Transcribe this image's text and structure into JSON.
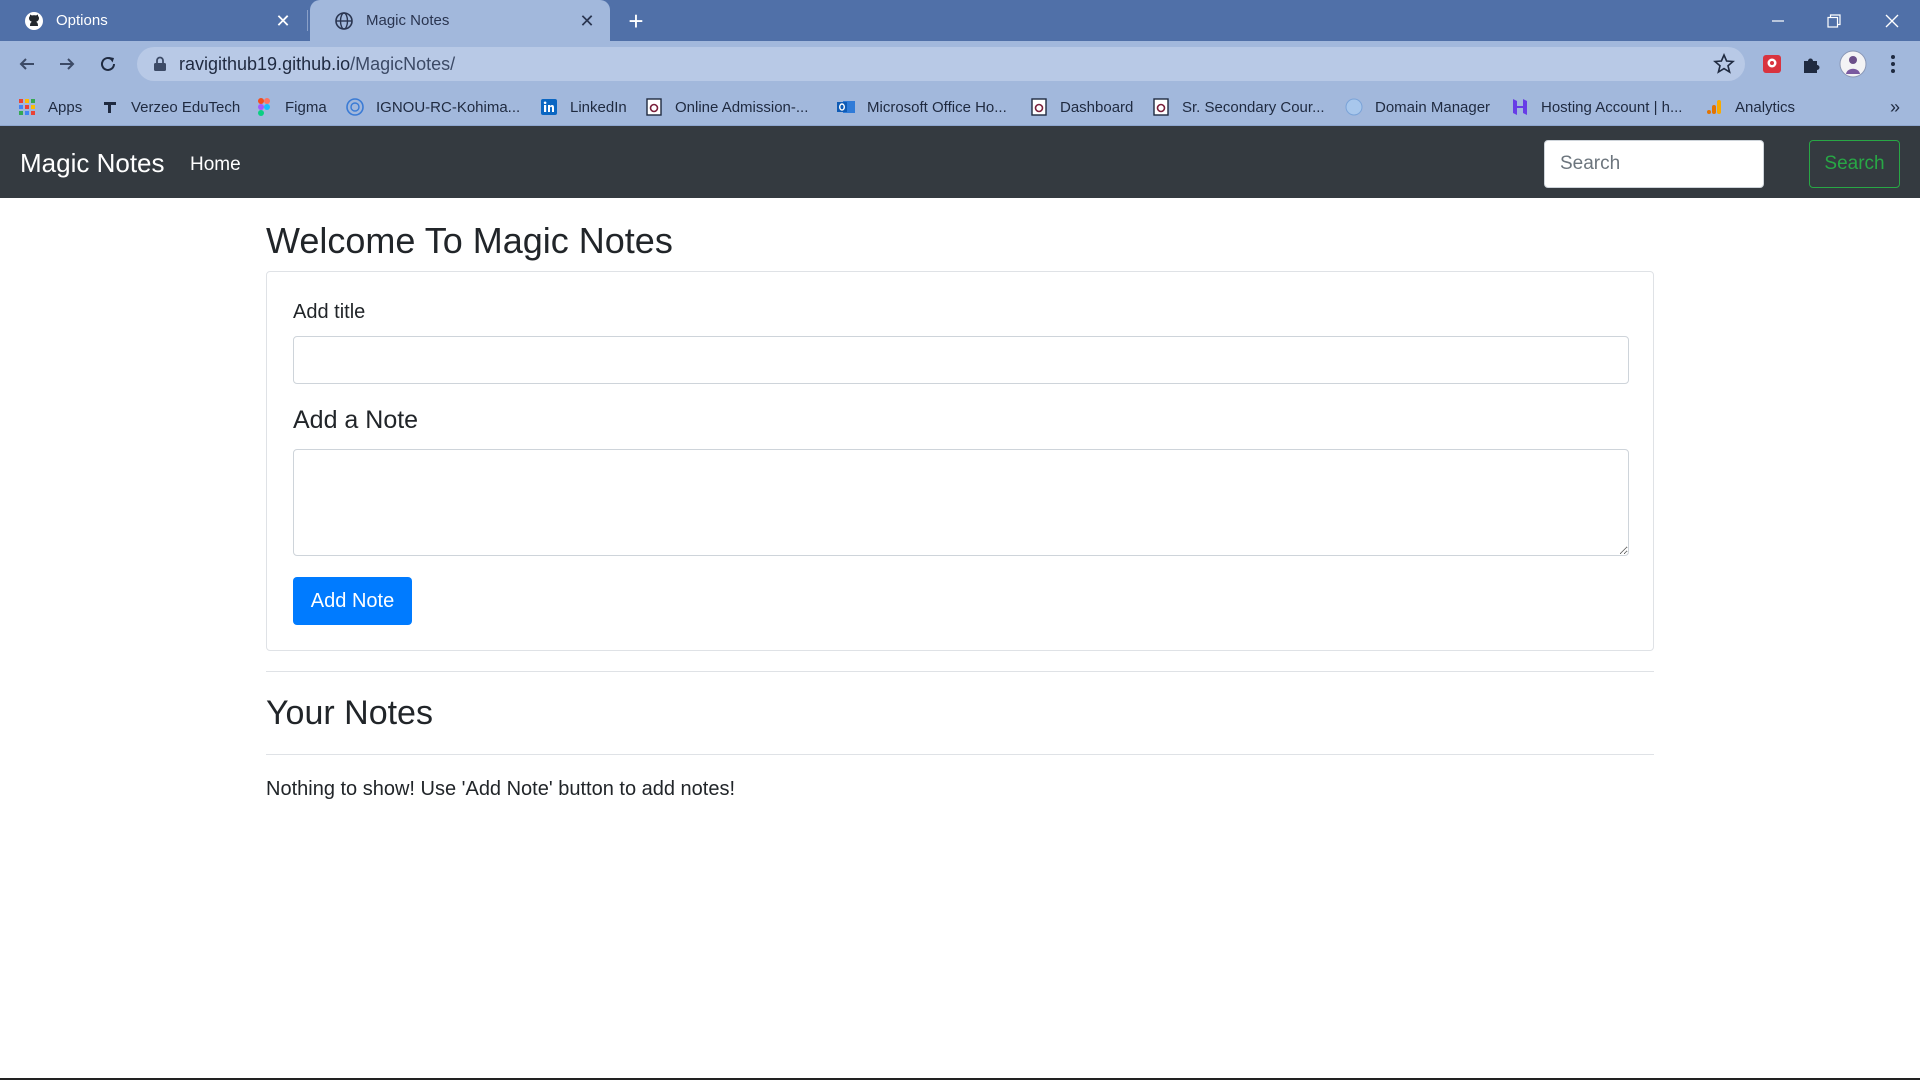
{
  "browser": {
    "tabs": [
      {
        "title": "Options",
        "icon": "github-icon",
        "active": false
      },
      {
        "title": "Magic Notes",
        "icon": "globe-icon",
        "active": true
      }
    ],
    "new_tab_label": "+",
    "url": {
      "host": "ravigithub19.github.io",
      "path": "/MagicNotes/"
    },
    "bookmarks": [
      {
        "label": "Apps",
        "icon": "apps-grid-icon"
      },
      {
        "label": "Verzeo EduTech",
        "icon": "verzeo-icon"
      },
      {
        "label": "Figma",
        "icon": "figma-icon"
      },
      {
        "label": "IGNOU-RC-Kohima...",
        "icon": "ignou-icon"
      },
      {
        "label": "LinkedIn",
        "icon": "linkedin-icon"
      },
      {
        "label": "Online Admission-...",
        "icon": "nios-icon"
      },
      {
        "label": "Microsoft Office Ho...",
        "icon": "outlook-icon"
      },
      {
        "label": "Dashboard",
        "icon": "nios-icon"
      },
      {
        "label": "Sr. Secondary Cour...",
        "icon": "nios-icon"
      },
      {
        "label": "Domain Manager",
        "icon": "globe-icon"
      },
      {
        "label": "Hosting Account | h...",
        "icon": "hostinger-icon"
      },
      {
        "label": "Analytics",
        "icon": "analytics-icon"
      }
    ],
    "more_bookmarks": "»"
  },
  "navbar": {
    "brand": "Magic Notes",
    "home": "Home",
    "search_placeholder": "Search",
    "search_button": "Search"
  },
  "main": {
    "heading": "Welcome To Magic Notes",
    "title_label": "Add title",
    "title_value": "",
    "note_label": "Add a Note",
    "note_value": "",
    "add_button": "Add Note",
    "notes_heading": "Your Notes",
    "empty_message": "Nothing to show! Use 'Add Note' button to add notes!"
  },
  "colors": {
    "tabstrip": "#5070a8",
    "toolbar": "#a2b8dc",
    "navbar": "#343a40",
    "primary": "#007bff",
    "success": "#28a745"
  }
}
